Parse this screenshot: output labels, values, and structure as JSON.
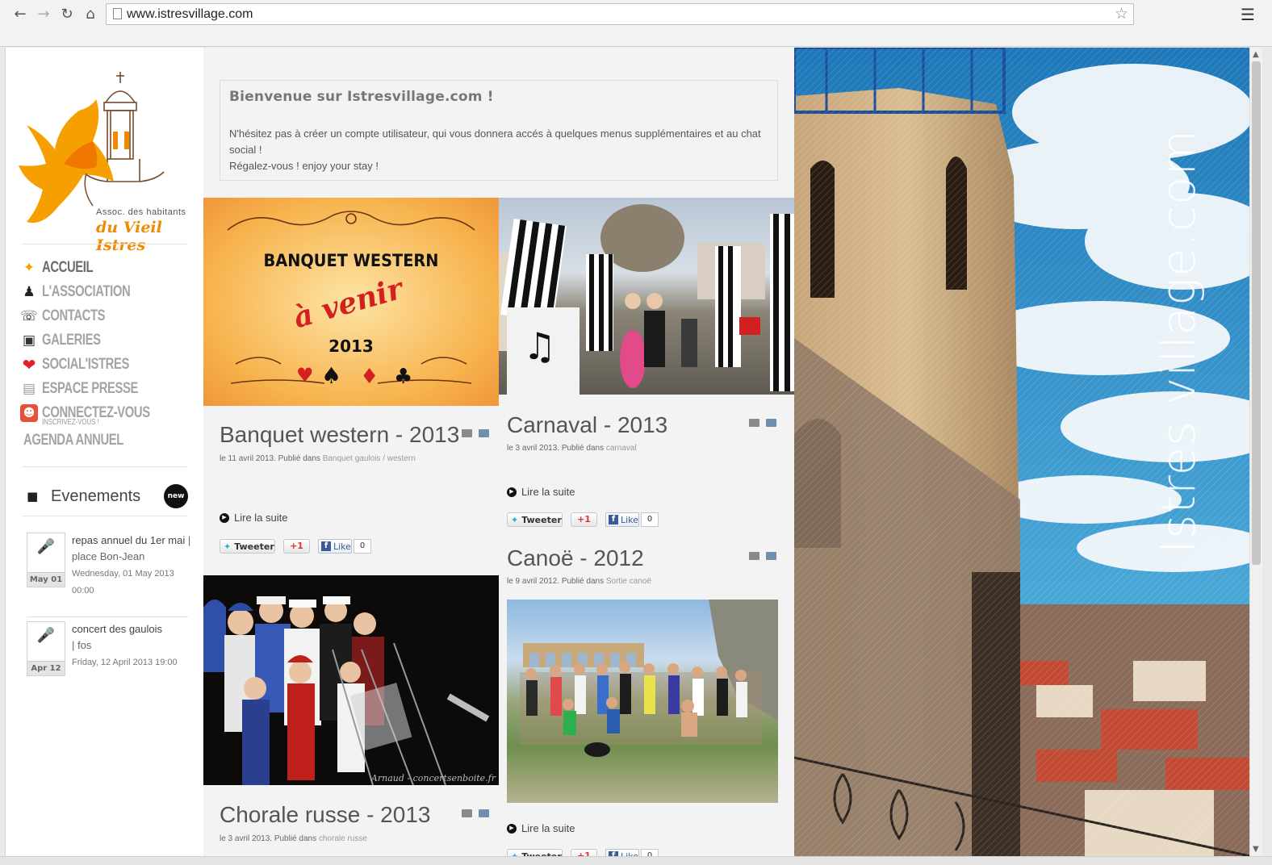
{
  "browser": {
    "url": "www.istresvillage.com",
    "back_icon": "back-arrow-icon",
    "forward_icon": "forward-arrow-icon",
    "reload_icon": "reload-icon",
    "home_icon": "home-icon",
    "star_icon": "star-icon",
    "menu_icon": "hamburger-menu-icon"
  },
  "logo": {
    "line1": "Assoc. des habitants",
    "line2": "du Vieil Istres",
    "colors": {
      "orange": "#f5a000",
      "dark_orange": "#f07800",
      "line": "#7a4b2a"
    }
  },
  "menu": [
    {
      "label": "ACCUEIL",
      "icon": "bird-icon",
      "active": true
    },
    {
      "label": "L'ASSOCIATION",
      "icon": "people-icon"
    },
    {
      "label": "CONTACTS",
      "icon": "telephone-icon"
    },
    {
      "label": "GALERIES",
      "icon": "camera-icon"
    },
    {
      "label": "SOCIAL'ISTRES",
      "icon": "heart-icon"
    },
    {
      "label": "ESPACE PRESSE",
      "icon": "newspaper-icon"
    },
    {
      "label": "CONNECTEZ-VOUS",
      "sub": "INSCRIVEZ-VOUS !",
      "icon": "user-icon"
    },
    {
      "label": "AGENDA ANNUEL",
      "icon": ""
    }
  ],
  "events": {
    "title": "Evenements",
    "badge": "new",
    "items": [
      {
        "title": "repas annuel du 1er mai",
        "sep": "|",
        "location": "place Bon-Jean",
        "date": "Wednesday, 01 May 2013 00:00",
        "cal": "May 01"
      },
      {
        "title": "concert des gaulois",
        "sep": "|",
        "location": "fos",
        "date": "Friday, 12 April 2013 19:00",
        "cal": "Apr 12"
      }
    ]
  },
  "welcome": {
    "title": "Bienvenue sur Istresvillage.com !",
    "line1": "N'hésitez pas à créer un compte utilisateur, qui vous donnera accés à quelques menus supplémentaires et au chat social !",
    "line2": "Régalez-vous ! enjoy your stay !"
  },
  "articles": [
    {
      "title": "Banquet western - 2013",
      "meta_prefix": "le 11 avril 2013. Publié dans",
      "cat1": "Banquet gaulois",
      "cat_sep": "/",
      "cat2": "western",
      "poster": {
        "line1": "BANQUET WESTERN",
        "line2": "à venir",
        "line3": "2013"
      }
    },
    {
      "title": "Carnaval - 2013",
      "meta_prefix": "le 3 avril 2013. Publié dans",
      "cat1": "carnaval"
    },
    {
      "title": "Canoë - 2012",
      "meta_prefix": "le 9 avril 2012. Publié dans",
      "cat1": "Sortie canoë"
    },
    {
      "title": "Chorale russe - 2013",
      "meta_prefix": "le 3 avril 2013. Publié dans",
      "cat1": "chorale russe",
      "photo_credit": "Arnaud - concertsenboite.fr"
    }
  ],
  "common": {
    "read_more": "Lire la suite",
    "tweet": "Tweeter",
    "gplus": "+1",
    "fb_like": "Like",
    "fb_count": "0"
  },
  "hero": {
    "watermark": "Istres village.com"
  }
}
